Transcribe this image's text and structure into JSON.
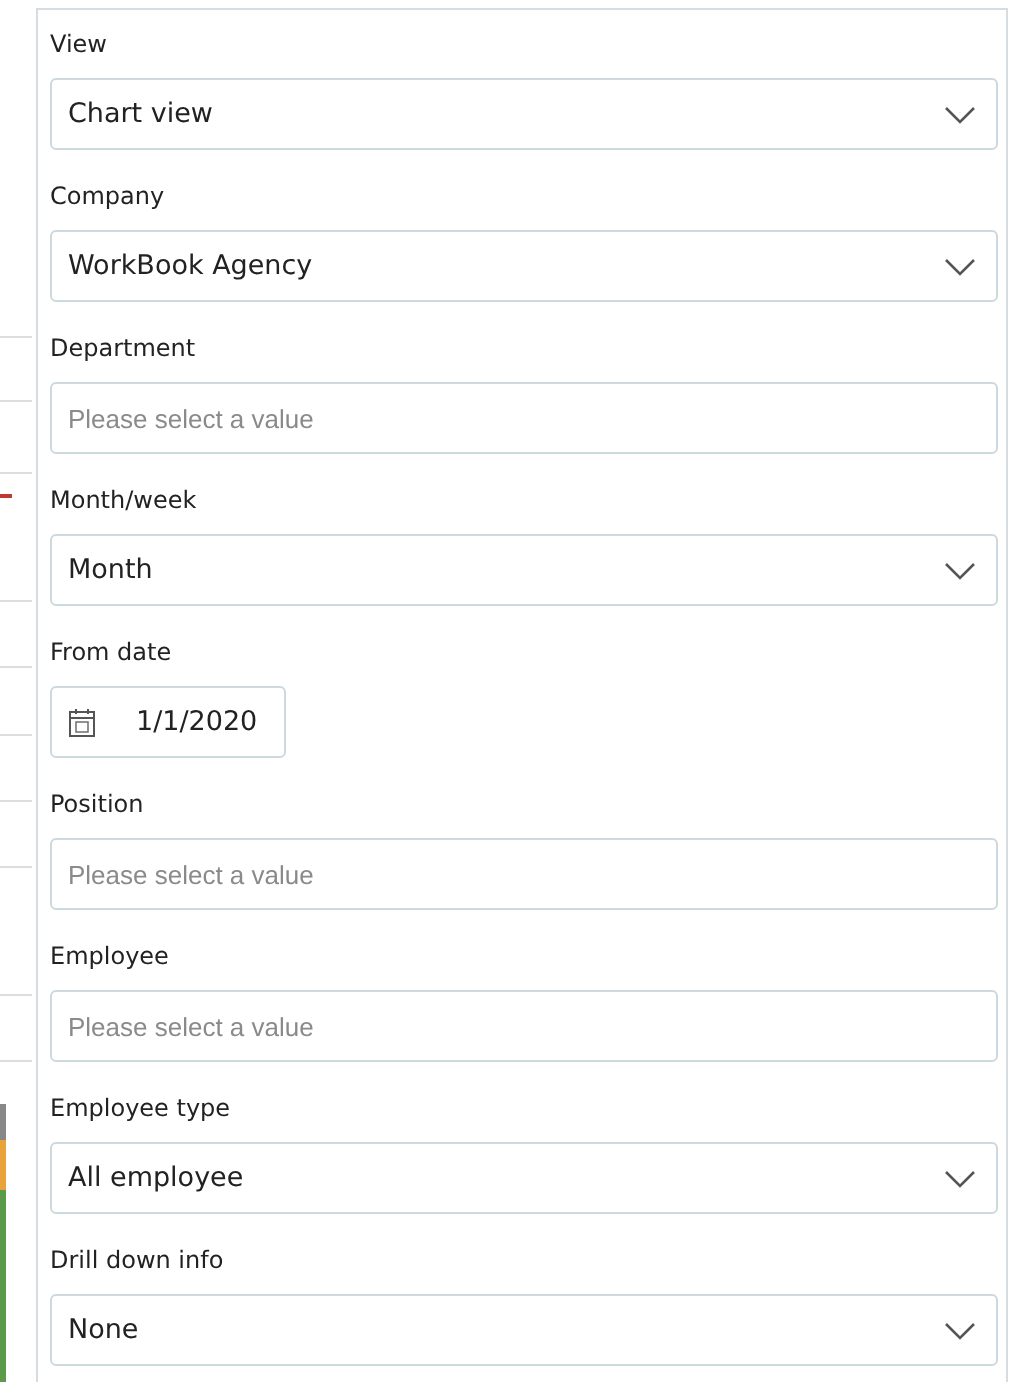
{
  "filters": [
    {
      "label": "View",
      "kind": "select",
      "value": "Chart view"
    },
    {
      "label": "Company",
      "kind": "select",
      "value": "WorkBook Agency"
    },
    {
      "label": "Department",
      "kind": "input",
      "placeholder": "Please select a value"
    },
    {
      "label": "Month/week",
      "kind": "select",
      "value": "Month"
    },
    {
      "label": "From date",
      "kind": "date",
      "value": "1/1/2020"
    },
    {
      "label": "Position",
      "kind": "input",
      "placeholder": "Please select a value"
    },
    {
      "label": "Employee",
      "kind": "input",
      "placeholder": "Please select a value"
    },
    {
      "label": "Employee type",
      "kind": "select",
      "value": "All employee"
    },
    {
      "label": "Drill down info",
      "kind": "select",
      "value": "None"
    }
  ]
}
